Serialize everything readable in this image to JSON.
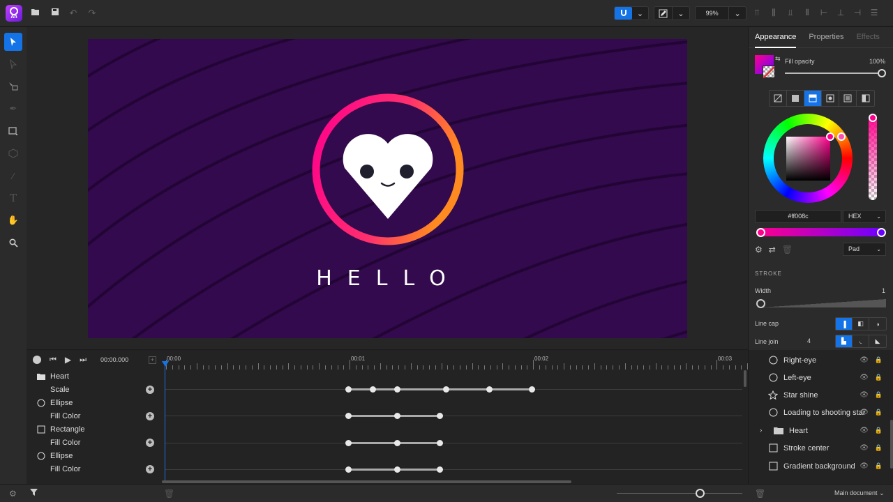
{
  "toolbar": {
    "app_logo_text": "An",
    "zoom": "99%"
  },
  "tools": [
    "select",
    "subselect",
    "transform",
    "pen",
    "rectangle",
    "3d",
    "eyedropper",
    "text",
    "hand",
    "zoom"
  ],
  "stage": {
    "title_text": "HELLO",
    "background_color": "#330a4d",
    "ring_gradient": [
      "#ff008c",
      "#ff8a1f"
    ]
  },
  "timeline": {
    "current_time": "00:00.000",
    "ruler_labels": [
      "00:00",
      "00:01",
      "00:02",
      "00:03"
    ],
    "tracks": [
      {
        "label": "Heart",
        "kind": "group"
      },
      {
        "label": "Scale",
        "kind": "property"
      },
      {
        "label": "Ellipse",
        "kind": "ellipse"
      },
      {
        "label": "Fill Color",
        "kind": "property"
      },
      {
        "label": "Rectangle",
        "kind": "rectangle"
      },
      {
        "label": "Fill Color",
        "kind": "property"
      },
      {
        "label": "Ellipse",
        "kind": "ellipse"
      },
      {
        "label": "Fill Color",
        "kind": "property"
      }
    ]
  },
  "panel": {
    "tabs": [
      "Appearance",
      "Properties",
      "Effects"
    ],
    "fill_opacity_label": "Fill opacity",
    "fill_opacity_value": "100%",
    "fill_opacity": 1.0,
    "hex_value": "#ff008c",
    "color_mode": "HEX",
    "gradient_start": "#ff008c",
    "gradient_end": "#6a00ff",
    "spread": "Pad",
    "stroke_title": "STROKE",
    "width_label": "Width",
    "width_value": "1",
    "line_cap_label": "Line cap",
    "line_join_label": "Line join",
    "line_join_value": "4"
  },
  "layers": [
    {
      "label": "Right-eye",
      "icon": "ellipse-icon"
    },
    {
      "label": "Left-eye",
      "icon": "ellipse-icon"
    },
    {
      "label": "Star shine",
      "icon": "star-icon"
    },
    {
      "label": "Loading to shooting star",
      "icon": "ellipse-icon"
    },
    {
      "label": "Heart",
      "icon": "folder-icon"
    },
    {
      "label": "Stroke center",
      "icon": "rectangle-icon"
    },
    {
      "label": "Gradient background",
      "icon": "rectangle-icon"
    }
  ],
  "bottom": {
    "document": "Main document"
  }
}
